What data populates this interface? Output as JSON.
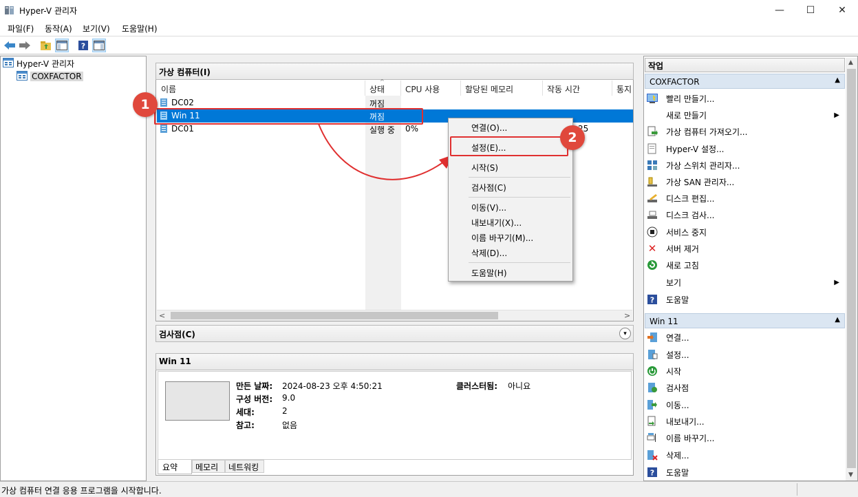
{
  "window": {
    "title": "Hyper-V 관리자",
    "minimize_glyph": "—",
    "maximize_glyph": "☐",
    "close_glyph": "✕"
  },
  "menu": [
    "파일(F)",
    "동작(A)",
    "보기(V)",
    "도움말(H)"
  ],
  "tree": {
    "root": "Hyper-V 관리자",
    "server": "COXFACTOR"
  },
  "vm_panel": {
    "title": "가상 컴퓨터(I)",
    "columns": [
      "이름",
      "상태",
      "CPU 사용",
      "할당된 메모리",
      "작동 시간",
      "통지"
    ],
    "rows": [
      {
        "name": "DC02",
        "state": "꺼짐",
        "cpu": "",
        "memory": "",
        "uptime": ""
      },
      {
        "name": "Win 11",
        "state": "꺼짐",
        "cpu": "",
        "memory": "",
        "uptime": ""
      },
      {
        "name": "DC01",
        "state": "실행 중",
        "cpu": "0%",
        "memory": "",
        "uptime": "25"
      }
    ]
  },
  "context_menu": {
    "items": [
      "연결(O)...",
      "설정(E)...",
      "시작(S)",
      "검사점(C)",
      "이동(V)...",
      "내보내기(X)...",
      "이름 바꾸기(M)...",
      "삭제(D)...",
      "도움말(H)"
    ]
  },
  "checkpoint_panel": {
    "title": "검사점(C)"
  },
  "details_panel": {
    "title": "Win 11",
    "fields": [
      {
        "label": "만든 날짜:",
        "value": "2024-08-23 오후 4:50:21"
      },
      {
        "label": "구성 버전:",
        "value": "9.0"
      },
      {
        "label": "세대:",
        "value": "2"
      },
      {
        "label": "참고:",
        "value": "없음"
      }
    ],
    "clustered_label": "클러스터됨:",
    "clustered_value": "아니요",
    "tabs": [
      "요약",
      "메모리",
      "네트워킹"
    ]
  },
  "actions": {
    "title": "작업",
    "server_group": "COXFACTOR",
    "server_items": [
      {
        "label": "빨리 만들기...",
        "icon": "quick-create-icon"
      },
      {
        "label": "새로 만들기",
        "icon": "",
        "submenu": true
      },
      {
        "label": "가상 컴퓨터 가져오기...",
        "icon": "import-vm-icon"
      },
      {
        "label": "Hyper-V 설정...",
        "icon": "hyperv-settings-icon"
      },
      {
        "label": "가상 스위치 관리자...",
        "icon": "virtual-switch-icon"
      },
      {
        "label": "가상 SAN 관리자...",
        "icon": "virtual-san-icon"
      },
      {
        "label": "디스크 편집...",
        "icon": "edit-disk-icon"
      },
      {
        "label": "디스크 검사...",
        "icon": "inspect-disk-icon"
      },
      {
        "label": "서비스 중지",
        "icon": "stop-service-icon"
      },
      {
        "label": "서버 제거",
        "icon": "remove-server-icon"
      },
      {
        "label": "새로 고침",
        "icon": "refresh-icon"
      },
      {
        "label": "보기",
        "icon": "",
        "submenu": true
      },
      {
        "label": "도움말",
        "icon": "help-icon"
      }
    ],
    "vm_group": "Win 11",
    "vm_items": [
      {
        "label": "연결...",
        "icon": "connect-icon"
      },
      {
        "label": "설정...",
        "icon": "settings-icon"
      },
      {
        "label": "시작",
        "icon": "start-icon"
      },
      {
        "label": "검사점",
        "icon": "checkpoint-icon"
      },
      {
        "label": "이동...",
        "icon": "move-icon"
      },
      {
        "label": "내보내기...",
        "icon": "export-icon"
      },
      {
        "label": "이름 바꾸기...",
        "icon": "rename-icon"
      },
      {
        "label": "삭제...",
        "icon": "delete-icon"
      },
      {
        "label": "도움말",
        "icon": "help-icon"
      }
    ]
  },
  "annotations": {
    "badge1": "1",
    "badge2": "2"
  },
  "status": "가상 컴퓨터 연결 응용 프로그램을 시작합니다.",
  "colors": {
    "selection": "#0078d7",
    "annotation_red": "#e03030",
    "group_header": "#dbe6f2"
  }
}
